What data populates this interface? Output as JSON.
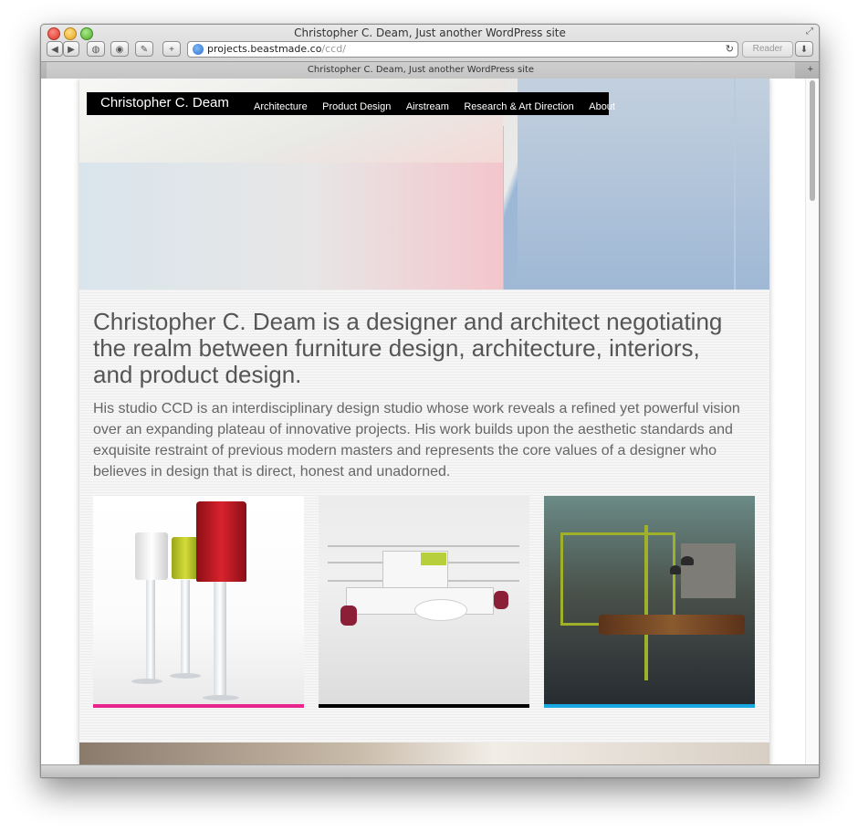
{
  "browser": {
    "window_title": "Christopher C. Deam, Just another WordPress site",
    "tab_title": "Christopher C. Deam, Just another WordPress site",
    "url_host": "projects.beastmade.co",
    "url_path": "/ccd/",
    "reader_label": "Reader",
    "back_label": "◀",
    "forward_label": "▶",
    "toolbar_icons": [
      "back-icon",
      "forward-icon",
      "sidebar-icon",
      "history-icon",
      "share-icon",
      "add-bookmark-icon",
      "reload-icon",
      "download-icon",
      "fullscreen-icon"
    ]
  },
  "site": {
    "brand": "Christopher C. Deam",
    "nav": [
      "Architecture",
      "Product Design",
      "Airstream",
      "Research & Art Direction",
      "About"
    ]
  },
  "content": {
    "headline": "Christopher C. Deam is a designer and architect negotiating the realm between furniture design, architecture, interiors, and product design.",
    "intro": "His studio CCD is an interdisciplinary design studio whose work reveals a refined yet powerful vision over an expanding plateau of innovative projects.  His work builds upon the aesthetic standards and exquisite restraint of previous modern masters and represents the core values of a designer who believes in design that is direct, honest and unadorned."
  },
  "tiles": [
    {
      "name": "product-design-tile",
      "accent": "#e8258d"
    },
    {
      "name": "office-furniture-tile",
      "accent": "#000000"
    },
    {
      "name": "architecture-tile",
      "accent": "#19a8e4"
    }
  ]
}
